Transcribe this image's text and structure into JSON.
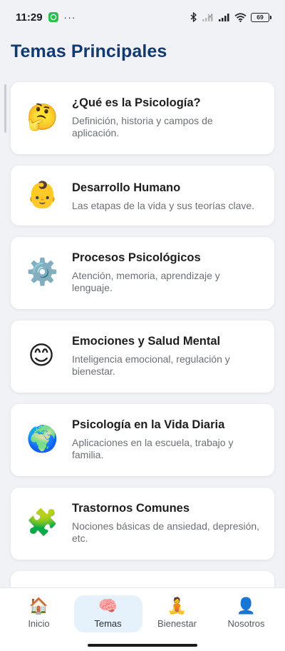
{
  "status_bar": {
    "time": "11:29",
    "notification_icons": [
      "whatsapp-icon",
      "more-dots-icon"
    ],
    "more_dots": "···",
    "system_icons": [
      "bluetooth-icon",
      "signal-weak-icon",
      "signal-icon",
      "wifi-icon"
    ],
    "battery": "69"
  },
  "page": {
    "title": "Temas Principales"
  },
  "topics": [
    {
      "icon": "thinking-face-icon",
      "emoji": "🤔",
      "title": "¿Qué es la Psicología?",
      "description": "Definición, historia y campos de aplicación."
    },
    {
      "icon": "baby-icon",
      "emoji": "👶",
      "title": "Desarrollo Humano",
      "description": "Las etapas de la vida y sus teorías clave."
    },
    {
      "icon": "gear-icon",
      "emoji": "⚙️",
      "title": "Procesos Psicológicos",
      "description": "Atención, memoria, aprendizaje y lenguaje."
    },
    {
      "icon": "smiling-face-icon",
      "emoji": "😊",
      "title": "Emociones y Salud Mental",
      "description": "Inteligencia emocional, regulación y bienestar."
    },
    {
      "icon": "globe-icon",
      "emoji": "🌍",
      "title": "Psicología en la Vida Diaria",
      "description": "Aplicaciones en la escuela, trabajo y familia."
    },
    {
      "icon": "puzzle-icon",
      "emoji": "🧩",
      "title": "Trastornos Comunes",
      "description": "Nociones básicas de ansiedad, depresión, etc."
    }
  ],
  "bottom_nav": [
    {
      "icon": "house-icon",
      "emoji": "🏠",
      "label": "Inicio",
      "active": false
    },
    {
      "icon": "brain-icon",
      "emoji": "🧠",
      "label": "Temas",
      "active": true
    },
    {
      "icon": "meditation-icon",
      "emoji": "🧘",
      "label": "Bienestar",
      "active": false
    },
    {
      "icon": "user-icon",
      "emoji": "👤",
      "label": "Nosotros",
      "active": false
    }
  ],
  "colors": {
    "title": "#123a6e",
    "background": "#f1f2f6",
    "active_tab": "#e6f2fb"
  }
}
